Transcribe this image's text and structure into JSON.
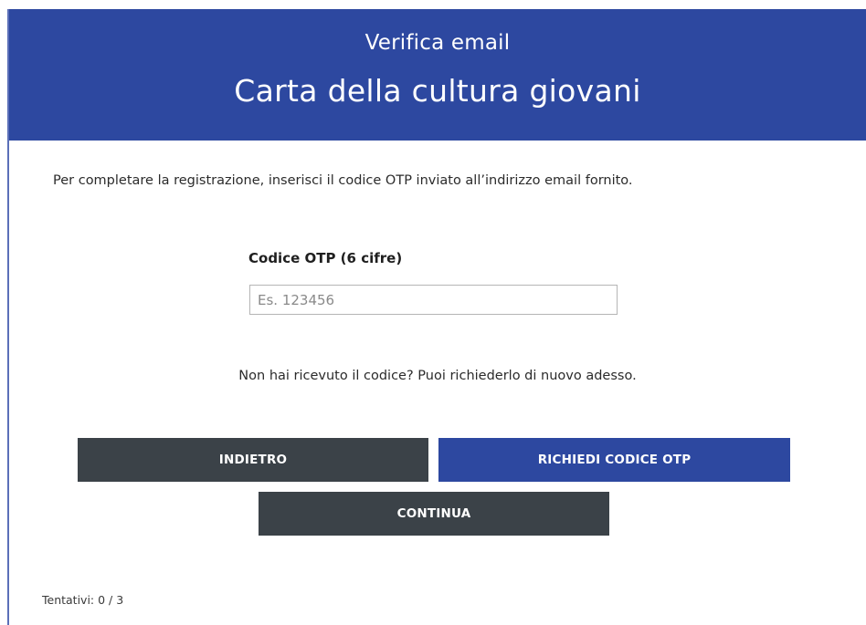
{
  "header": {
    "subtitle": "Verifica email",
    "title": "Carta della cultura giovani"
  },
  "intro_text": "Per completare la registrazione, inserisci il codice OTP inviato all’indirizzo email fornito.",
  "otp_field": {
    "label": "Codice OTP (6 cifre)",
    "value": "",
    "placeholder": "Es. 123456"
  },
  "resend_text": "Non hai ricevuto il codice? Puoi richiederlo di nuovo adesso.",
  "buttons": {
    "back_label": "INDIETRO",
    "request_label": "RICHIEDI CODICE OTP",
    "continue_label": "CONTINUA"
  },
  "attempts_text": "Tentativi: 0 / 3",
  "colors": {
    "brand_blue": "#2d48a0",
    "dark_button": "#3b4248"
  }
}
